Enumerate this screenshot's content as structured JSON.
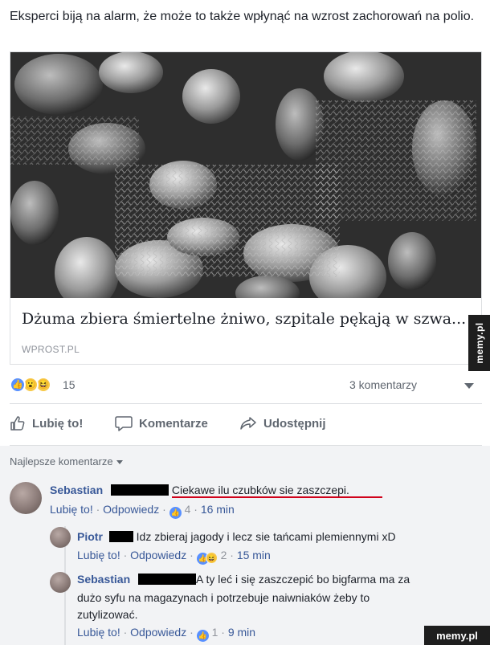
{
  "post": {
    "text": "Eksperci biją na alarm, że może to także wpłynąć na wzrost zachorowań na polio."
  },
  "link_preview": {
    "title": "Dżuma zbiera śmiertelne żniwo, szpitale pękają w szwa...",
    "domain": "WPROST.PL"
  },
  "reactions": {
    "count": "15",
    "comments": "3 komentarzy",
    "icons": [
      "like-icon",
      "wow-icon",
      "haha-icon"
    ]
  },
  "actions": {
    "like": "Lubię to!",
    "comment": "Komentarze",
    "share": "Udostępnij"
  },
  "comments_section": {
    "sort_label": "Najlepsze komentarze",
    "comments": [
      {
        "author": "Sebastian",
        "text": "Ciekawe ilu czubków sie zaszczepi.",
        "like": "Lubię to!",
        "reply": "Odpowiedz",
        "reactions": "4",
        "time": "16 min"
      },
      {
        "author": "Piotr",
        "text": "Idz zbieraj jagody i lecz sie tańcami plemiennymi xD",
        "like": "Lubię to!",
        "reply": "Odpowiedz",
        "reactions": "2",
        "time": "15 min"
      },
      {
        "author": "Sebastian",
        "text_line1": "A ty leć i się zaszczepić bo bigfarma ma za",
        "text_line2": "dużo syfu na magazynach i potrzebuje naiwniaków żeby to",
        "text_line3": "zutylizować.",
        "like": "Lubię to!",
        "reply": "Odpowiedz",
        "reactions": "1",
        "time": "9 min"
      }
    ]
  },
  "watermarks": {
    "side": "memy.pl",
    "bottom": "memy.pl"
  },
  "colors": {
    "link_blue": "#385898",
    "meta_grey": "#90949c",
    "like_blue": "#5890ff",
    "underline_red": "#d0021b"
  }
}
